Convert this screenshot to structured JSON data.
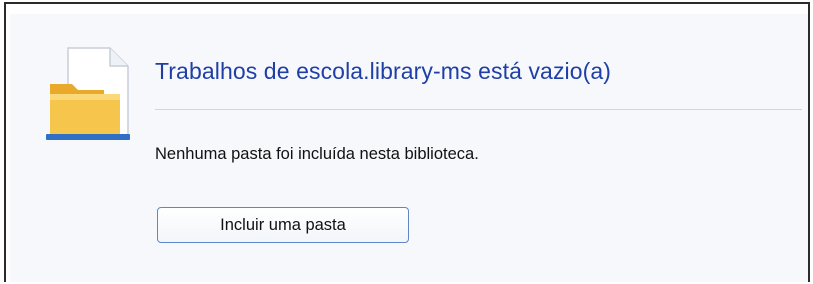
{
  "library": {
    "title": "Trabalhos de escola.library-ms está vazio(a)",
    "message": "Nenhuma pasta foi incluída nesta biblioteca.",
    "include_button_label": "Incluir uma pasta"
  },
  "icons": {
    "folder": "folder-with-document-icon"
  },
  "colors": {
    "title": "#1f3fa6",
    "panel_bg": "#f6f8fc",
    "button_border": "#5f87c6"
  }
}
